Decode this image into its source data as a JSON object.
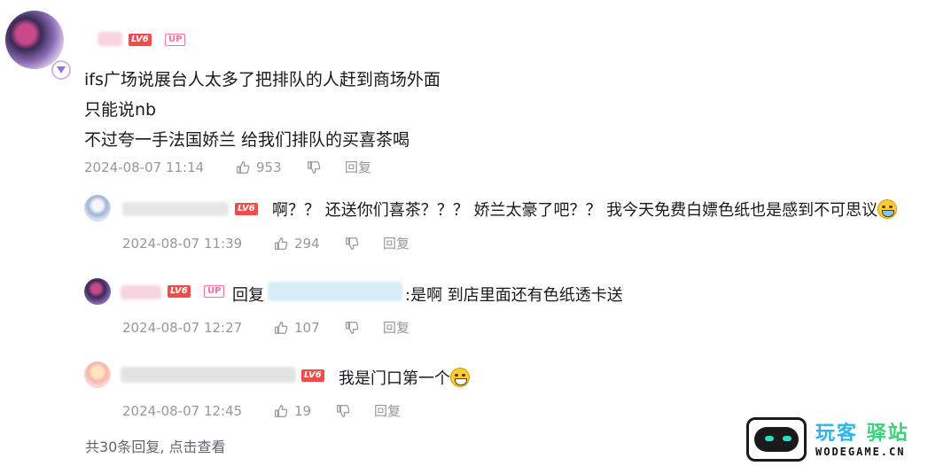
{
  "comments": {
    "main": {
      "level": "LV6",
      "up_badge": "UP",
      "lines": [
        "ifs广场说展台人太多了把排队的人赶到商场外面",
        "只能说nb",
        "不过夸一手法国娇兰 给我们排队的买喜茶喝"
      ],
      "time": "2024-08-07 11:14",
      "likes": "953",
      "reply_label": "回复"
    },
    "replies": [
      {
        "level": "LV6",
        "text": "啊？？ 还送你们喜茶？？？ 娇兰太豪了吧？？ 我今天免费白嫖色纸也是感到不可思议",
        "emoji": "laugh-cry-emoji",
        "time": "2024-08-07 11:39",
        "likes": "294",
        "reply_label": "回复"
      },
      {
        "level": "LV6",
        "up_badge": "UP",
        "reply_prefix": "回复",
        "text": ":是啊 到店里面还有色纸透卡送",
        "time": "2024-08-07 12:27",
        "likes": "107",
        "reply_label": "回复"
      },
      {
        "level": "LV6",
        "text": "我是门口第一个",
        "emoji": "grin-emoji",
        "time": "2024-08-07 12:45",
        "likes": "19",
        "reply_label": "回复"
      }
    ],
    "more_replies": "共30条回复, 点击查看"
  },
  "watermark": {
    "cn_part1": "玩客",
    "cn_part2": "驿站",
    "en": "WODEGAME.CN"
  },
  "colors": {
    "level_badge": "#f04c49",
    "up_badge": "#fb7299",
    "meta_text": "#9499a0"
  }
}
